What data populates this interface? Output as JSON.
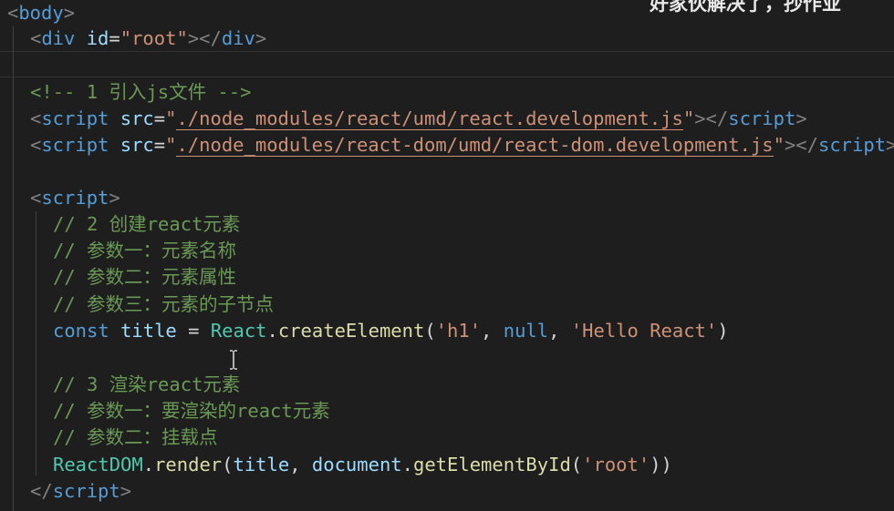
{
  "overlay_caption": "好家伙解决了，抄作业",
  "code": {
    "body_open": "body",
    "div_tag": "div",
    "div_attr": "id",
    "div_value": "\"root\"",
    "comment1": "<!-- 1 引入js文件 -->",
    "script_tag": "script",
    "src_attr": "src",
    "script1_src": "./node_modules/react/umd/react.development.js",
    "script2_src": "./node_modules/react-dom/umd/react-dom.development.js",
    "comment2": "// 2 创建react元素",
    "comment3": "// 参数一：元素名称",
    "comment4": "// 参数二：元素属性",
    "comment5": "// 参数三：元素的子节点",
    "const_kw": "const",
    "title_var": "title",
    "react_cls": "React",
    "create_fn": "createElement",
    "arg_h1": "'h1'",
    "arg_null": "null",
    "arg_hello": "'Hello React'",
    "comment6": "// 3 渲染react元素",
    "comment7": "// 参数一：要渲染的react元素",
    "comment8": "// 参数二：挂载点",
    "reactdom_cls": "ReactDOM",
    "render_fn": "render",
    "document_var": "document",
    "getbyid_fn": "getElementById",
    "arg_root": "'root'"
  }
}
